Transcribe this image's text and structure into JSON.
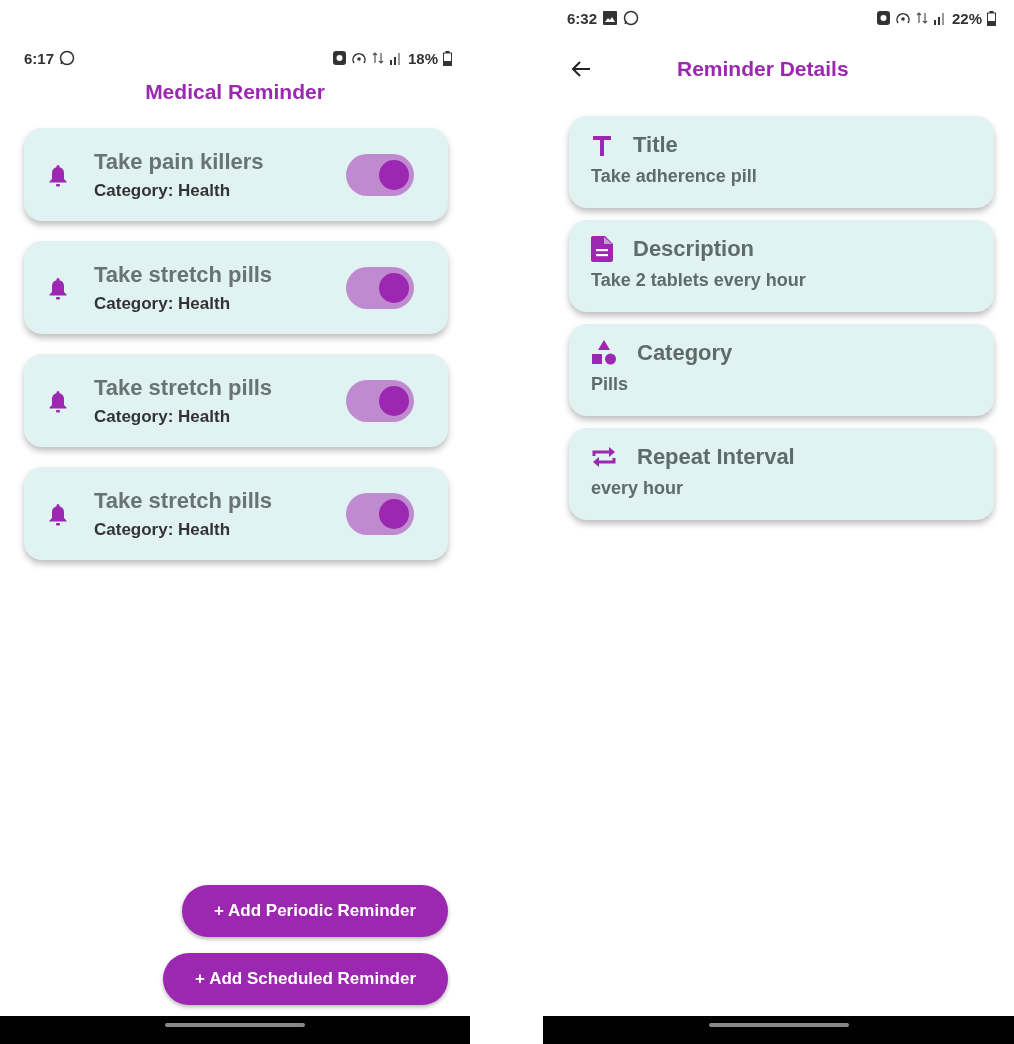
{
  "list_screen": {
    "status_bar": {
      "time": "6:17",
      "notifications": [
        {
          "kind": "chat"
        }
      ],
      "battery": "18%"
    },
    "title": "Medical Reminder",
    "reminders": [
      {
        "title": "Take pain killers",
        "category": "Category: Health",
        "on": true
      },
      {
        "title": "Take stretch pills",
        "category": "Category: Health",
        "on": true
      },
      {
        "title": "Take stretch pills",
        "category": "Category: Health",
        "on": true
      },
      {
        "title": "Take stretch pills",
        "category": "Category: Health",
        "on": true
      }
    ],
    "buttons": [
      "+ Add Periodic Reminder",
      "+ Add Scheduled Reminder"
    ]
  },
  "details_screen": {
    "status_bar": {
      "time": "6:32",
      "notifications": [
        {
          "kind": "image"
        },
        {
          "kind": "chat"
        }
      ],
      "battery": "22%"
    },
    "title": "Reminder Details",
    "fields": [
      {
        "kind": "title",
        "label": "Title",
        "value": "Take adherence pill"
      },
      {
        "kind": "description",
        "label": "Description",
        "value": "Take 2 tablets every hour"
      },
      {
        "kind": "category",
        "label": "Category",
        "value": "Pills"
      },
      {
        "kind": "repeat",
        "label": "Repeat Interval",
        "value": "every hour"
      }
    ]
  }
}
